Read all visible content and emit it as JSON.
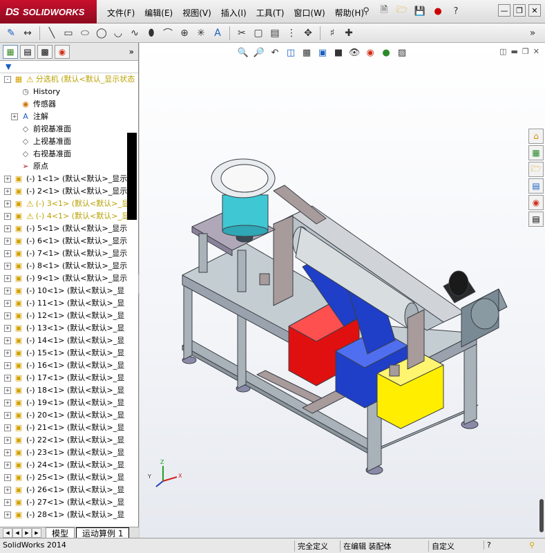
{
  "app": {
    "brand_ds": "DS",
    "brand_name": "SOLIDWORKS",
    "menu": [
      "文件(F)",
      "编辑(E)",
      "视图(V)",
      "插入(I)",
      "工具(T)",
      "窗口(W)",
      "帮助(H)"
    ]
  },
  "panel": {
    "tree": [
      {
        "label": "分选机  (默认<默认_显示状态",
        "icon": "assembly-icon",
        "exp": "-",
        "warn": true,
        "kind": "root"
      },
      {
        "label": "History",
        "icon": "history-icon",
        "exp": "",
        "kind": "item"
      },
      {
        "label": "传感器",
        "icon": "sensor-icon",
        "exp": "",
        "kind": "item"
      },
      {
        "label": "注解",
        "icon": "annotation-icon",
        "exp": "+",
        "kind": "item"
      },
      {
        "label": "前视基准面",
        "icon": "plane-icon",
        "exp": "",
        "kind": "item"
      },
      {
        "label": "上视基准面",
        "icon": "plane-icon",
        "exp": "",
        "kind": "item"
      },
      {
        "label": "右视基准面",
        "icon": "plane-icon",
        "exp": "",
        "kind": "item"
      },
      {
        "label": "原点",
        "icon": "origin-icon",
        "exp": "",
        "kind": "item"
      },
      {
        "label": "(-) 1<1> (默认<默认>_显示",
        "icon": "part-icon",
        "exp": "+",
        "kind": "part"
      },
      {
        "label": "(-) 2<1> (默认<默认>_显示",
        "icon": "part-icon",
        "exp": "+",
        "kind": "part"
      },
      {
        "label": "(-) 3<1> (默认<默认>_显",
        "icon": "part-icon",
        "exp": "+",
        "warn": true,
        "kind": "warnpart"
      },
      {
        "label": "(-) 4<1> (默认<默认>_显",
        "icon": "part-icon",
        "exp": "+",
        "warn": true,
        "kind": "warnpart"
      },
      {
        "label": "(-) 5<1> (默认<默认>_显示",
        "icon": "part-icon",
        "exp": "+",
        "kind": "part"
      },
      {
        "label": "(-) 6<1> (默认<默认>_显示",
        "icon": "part-icon",
        "exp": "+",
        "kind": "part"
      },
      {
        "label": "(-) 7<1> (默认<默认>_显示",
        "icon": "part-icon",
        "exp": "+",
        "kind": "part"
      },
      {
        "label": "(-) 8<1> (默认<默认>_显示",
        "icon": "part-icon",
        "exp": "+",
        "kind": "part"
      },
      {
        "label": "(-) 9<1> (默认<默认>_显示",
        "icon": "part-icon",
        "exp": "+",
        "kind": "part"
      },
      {
        "label": "(-) 10<1> (默认<默认>_显",
        "icon": "part-icon",
        "exp": "+",
        "kind": "part"
      },
      {
        "label": "(-) 11<1> (默认<默认>_显",
        "icon": "part-icon",
        "exp": "+",
        "kind": "part"
      },
      {
        "label": "(-) 12<1> (默认<默认>_显",
        "icon": "part-icon",
        "exp": "+",
        "kind": "part"
      },
      {
        "label": "(-) 13<1> (默认<默认>_显",
        "icon": "part-icon",
        "exp": "+",
        "kind": "part"
      },
      {
        "label": "(-) 14<1> (默认<默认>_显",
        "icon": "part-icon",
        "exp": "+",
        "kind": "part"
      },
      {
        "label": "(-) 15<1> (默认<默认>_显",
        "icon": "part-icon",
        "exp": "+",
        "kind": "part"
      },
      {
        "label": "(-) 16<1> (默认<默认>_显",
        "icon": "part-icon",
        "exp": "+",
        "kind": "part"
      },
      {
        "label": "(-) 17<1> (默认<默认>_显",
        "icon": "part-icon",
        "exp": "+",
        "kind": "part"
      },
      {
        "label": "(-) 18<1> (默认<默认>_显",
        "icon": "part-icon",
        "exp": "+",
        "kind": "part"
      },
      {
        "label": "(-) 19<1> (默认<默认>_显",
        "icon": "part-icon",
        "exp": "+",
        "kind": "part"
      },
      {
        "label": "(-) 20<1> (默认<默认>_显",
        "icon": "part-icon",
        "exp": "+",
        "kind": "part"
      },
      {
        "label": "(-) 21<1> (默认<默认>_显",
        "icon": "part-icon",
        "exp": "+",
        "kind": "part"
      },
      {
        "label": "(-) 22<1> (默认<默认>_显",
        "icon": "part-icon",
        "exp": "+",
        "kind": "part"
      },
      {
        "label": "(-) 23<1> (默认<默认>_显",
        "icon": "part-icon",
        "exp": "+",
        "kind": "part"
      },
      {
        "label": "(-) 24<1> (默认<默认>_显",
        "icon": "part-icon",
        "exp": "+",
        "kind": "part"
      },
      {
        "label": "(-) 25<1> (默认<默认>_显",
        "icon": "part-icon",
        "exp": "+",
        "kind": "part"
      },
      {
        "label": "(-) 26<1> (默认<默认>_显",
        "icon": "part-icon",
        "exp": "+",
        "kind": "part"
      },
      {
        "label": "(-) 27<1> (默认<默认>_显",
        "icon": "part-icon",
        "exp": "+",
        "kind": "part"
      },
      {
        "label": "(-) 28<1> (默认<默认>_显",
        "icon": "part-icon",
        "exp": "+",
        "kind": "part"
      }
    ],
    "tabs": [
      "模型",
      "运动算例 1"
    ]
  },
  "statusbar": {
    "app": "SolidWorks 2014",
    "constraint": "完全定义",
    "mode": "在编辑 装配体",
    "units": "自定义",
    "help": "?"
  },
  "viewport": {
    "triad_labels": [
      "Z",
      "Y",
      "X"
    ]
  },
  "colors": {
    "accent": "#c8102e",
    "warn": "#c9a400",
    "frame": "#9aa3ad",
    "blue": "#1f3fc8",
    "red": "#e01010",
    "yellow": "#ffee00",
    "teal": "#3fc7d4"
  }
}
